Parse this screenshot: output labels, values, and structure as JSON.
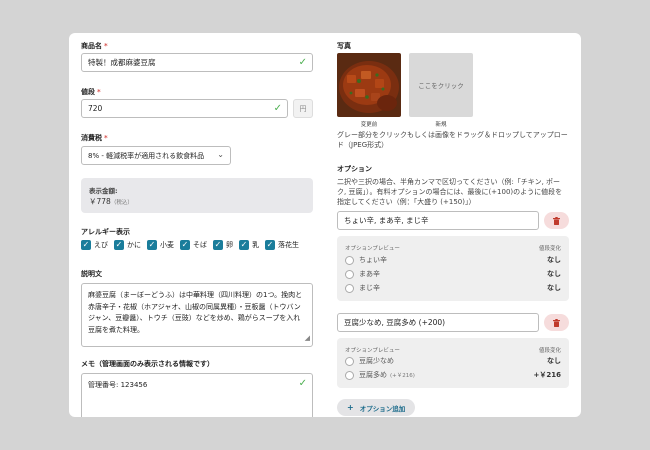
{
  "product": {
    "name_label": "商品名",
    "required_mark": "*",
    "name_value": "特製！成都麻婆豆腐",
    "price_label": "値段",
    "price_value": "720",
    "price_unit": "円",
    "tax_label": "消費税",
    "tax_value": "8% - 軽減税率が適用される飲食料品",
    "display_price_label": "表示金額:",
    "display_price_value": "￥778",
    "display_price_note": "（税込）",
    "allergy_label": "アレルギー表示",
    "allergies": [
      "えび",
      "かに",
      "小麦",
      "そば",
      "卵",
      "乳",
      "落花生"
    ],
    "description_label": "説明文",
    "description_value": "麻婆豆腐（まーぼーどうふ）は中華料理（四川料理）の1つ。挽肉と赤唐辛子・花椒（ホアジャオ、山椒の同属異種）・豆板醤（トウバンジャン、豆瓣醤）、トウチ（豆豉）などを炒め、鶏がらスープを入れ豆腐を煮た料理。",
    "memo_label": "メモ（管理画面のみ表示される情報です）",
    "memo_value": "管理番号: 123456"
  },
  "photo": {
    "label": "写真",
    "change_caption": "変更前",
    "new_placeholder": "ここをクリック",
    "new_caption": "新規",
    "help": "グレー部分をクリックもしくは画像をドラッグ＆ドロップしてアップロード（JPEG形式）"
  },
  "options": {
    "label": "オプション",
    "help": "二択や三択の場合、半角カンマで区切ってください（例:「チキン, ポーク, 豆腐」）。有料オプションの場合には、最後に(+100)のように値段を指定してください（例：「大盛り (+150)」）",
    "preview_header": "オプションプレビュー",
    "price_header": "値段変化",
    "groups": [
      {
        "value": "ちょい辛, まあ辛, まじ辛",
        "items": [
          {
            "label": "ちょい辛",
            "sub": "",
            "price": "なし"
          },
          {
            "label": "まあ辛",
            "sub": "",
            "price": "なし"
          },
          {
            "label": "まじ辛",
            "sub": "",
            "price": "なし"
          }
        ]
      },
      {
        "value": "豆腐少なめ, 豆腐多め (+200)",
        "items": [
          {
            "label": "豆腐少なめ",
            "sub": "",
            "price": "なし"
          },
          {
            "label": "豆腐多め",
            "sub": "(+￥216)",
            "price": "+￥216"
          }
        ]
      }
    ],
    "add_button": "オプション追加",
    "add_icon": "+"
  },
  "icons": {
    "check": "✓",
    "chevron": "⌄",
    "trash": "trash-icon"
  },
  "colors": {
    "accent": "#1a7d9b",
    "check": "#4caf50",
    "delete_bg": "#f6dcdc",
    "delete_icon": "#c0392b"
  }
}
